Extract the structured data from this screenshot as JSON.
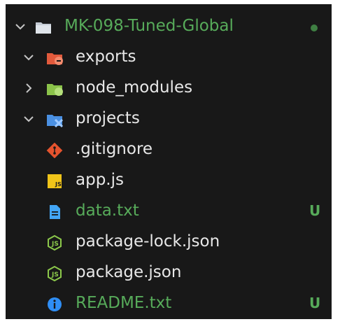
{
  "colors": {
    "background": "#181818",
    "text_default": "#e6e6e6",
    "text_git_untracked": "#57ab5a",
    "root_dot": "#3f7f43",
    "chevron": "#c5c5c5",
    "folder_gray": "#c4cbd4",
    "folder_exports": "#e25a3c",
    "folder_exports_badge": "#f28b6e",
    "folder_node": "#8bc34a",
    "folder_node_badge": "#b5e07c",
    "folder_projects": "#4a90e2",
    "folder_projects_badge": "#9ec9ff",
    "git_icon": "#e4532e",
    "js_icon_bg": "#f0c419",
    "js_icon_text": "#1b1b1b",
    "file_doc": "#42a5f5",
    "node_json_icon": "#8cc84b",
    "info_icon": "#2f8ef5"
  },
  "tree": {
    "root": {
      "name": "MK-098-Tuned-Global",
      "expanded": true,
      "icon": "folder-open-icon"
    },
    "items": [
      {
        "name": "exports",
        "type": "folder",
        "expanded": true,
        "icon": "folder-exports-icon",
        "status": ""
      },
      {
        "name": "node_modules",
        "type": "folder",
        "expanded": false,
        "icon": "folder-node-modules-icon",
        "status": ""
      },
      {
        "name": "projects",
        "type": "folder",
        "expanded": true,
        "icon": "folder-projects-icon",
        "status": ""
      },
      {
        "name": ".gitignore",
        "type": "file",
        "icon": "git-icon",
        "status": ""
      },
      {
        "name": "app.js",
        "type": "file",
        "icon": "js-file-icon",
        "status": ""
      },
      {
        "name": "data.txt",
        "type": "file",
        "icon": "text-file-icon",
        "status": "U"
      },
      {
        "name": "package-lock.json",
        "type": "file",
        "icon": "nodejs-icon",
        "status": ""
      },
      {
        "name": "package.json",
        "type": "file",
        "icon": "nodejs-icon",
        "status": ""
      },
      {
        "name": "README.txt",
        "type": "file",
        "icon": "info-icon",
        "status": "U"
      }
    ]
  }
}
